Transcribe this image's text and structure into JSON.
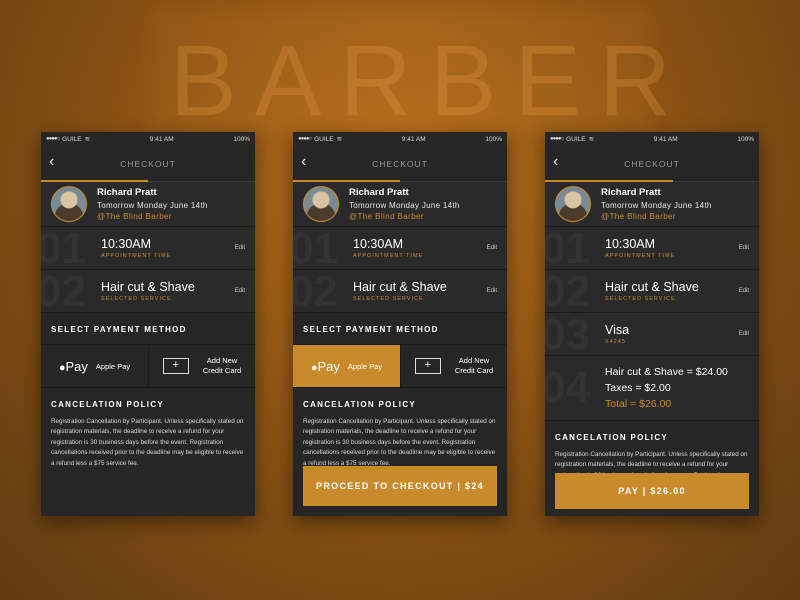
{
  "background": {
    "text": "BARBER"
  },
  "accent_color": "#c98a2b",
  "status_bar": {
    "carrier": "GUILE",
    "time": "9:41 AM",
    "battery": "100%"
  },
  "header": {
    "title": "CHECKOUT"
  },
  "profile": {
    "name": "Richard Pratt",
    "date": "Tomorrow Monday June 14th",
    "shop": "@The Blind Barber"
  },
  "appointment": {
    "number": "01",
    "time": "10:30AM",
    "label": "APPOINTMENT TIME",
    "edit": "Edit"
  },
  "service": {
    "number": "02",
    "name": "Hair cut & Shave",
    "label": "SELECTED SERVICE",
    "edit": "Edit"
  },
  "payment_section": {
    "title": "SELECT PAYMENT METHOD",
    "apple_pay_logo": "Pay",
    "apple_pay_label": "Apple Pay",
    "add_card_label_line1": "Add New",
    "add_card_label_line2": "Credit Card",
    "plus": "+"
  },
  "selected_card": {
    "number": "03",
    "name": "Visa",
    "last4": "X4245",
    "edit": "Edit"
  },
  "totals": {
    "number": "04",
    "service_line": "Hair cut & Shave = $24.00",
    "tax_line": "Taxes = $2.00",
    "total_line": "Total = $26.00"
  },
  "policy": {
    "title": "CANCELATION POLICY",
    "text": "Registration Cancellation by Participant. Unless specifically stated on registration materials, the deadline to receive a refund for your registration is 30 business days before the event. Registration cancellations received prior to the deadline may be eligible to receive a refund less a $75 service fee."
  },
  "screens": {
    "checkout_button": "PROCEED TO CHECKOUT  |  $24",
    "pay_button": "PAY | $26.00"
  }
}
